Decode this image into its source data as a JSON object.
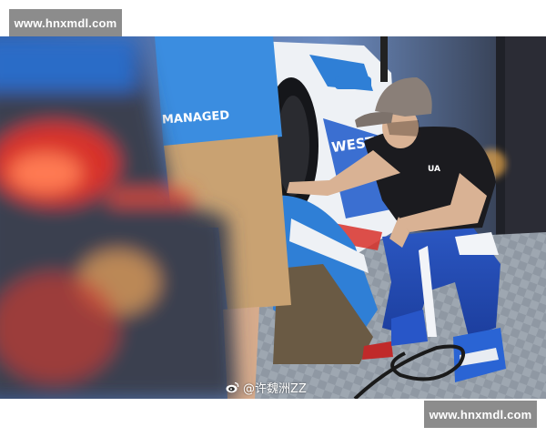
{
  "watermarks": {
    "top": "www.hnxmdl.com",
    "bottom": "www.hnxmdl.com"
  },
  "photo": {
    "credit_handle": "@许魏洲ZZ",
    "credit_icon": "weibo-icon",
    "shirt_print": "MANAGED",
    "car_print": "WEST"
  },
  "colors": {
    "watermark_bg": "#8c8c8c",
    "team_blue": "#2f7fd6",
    "racing_navy": "#1f3c8a",
    "shirt_black": "#1b1b1f",
    "cap_grey": "#8a7f78",
    "taillight_red": "#d8312a"
  }
}
